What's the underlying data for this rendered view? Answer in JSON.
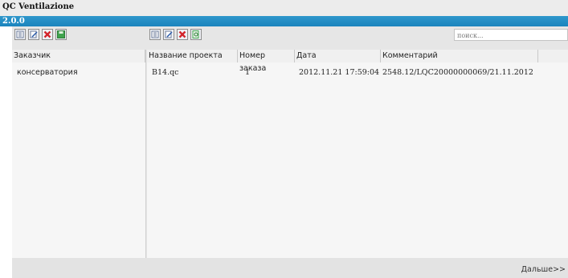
{
  "window": {
    "title": "QC Ventilazione",
    "version": "2.0.0"
  },
  "search": {
    "placeholder": "поиск..."
  },
  "customers": {
    "column_header": "Заказчик",
    "rows": [
      "консерватория"
    ]
  },
  "projects": {
    "columns": [
      "Название проекта",
      "Номер заказа",
      "Дата",
      "Комментарий"
    ],
    "rows": [
      {
        "name": "B14.qc",
        "order": "1",
        "date": "2012.11.21 17:59:04",
        "comment": "2548.12/LQC20000000069/21.11.2012"
      }
    ]
  },
  "footer": {
    "next_label": "Дальше>>"
  },
  "colors": {
    "accent": "#1b84bd",
    "delete": "#d2232a",
    "save": "#3fa34d"
  },
  "icons": {
    "left_toolbar": [
      "list-icon",
      "edit-icon",
      "delete-icon",
      "save-icon"
    ],
    "right_toolbar": [
      "list-icon",
      "edit-icon",
      "delete-icon",
      "search-doc-icon"
    ]
  }
}
